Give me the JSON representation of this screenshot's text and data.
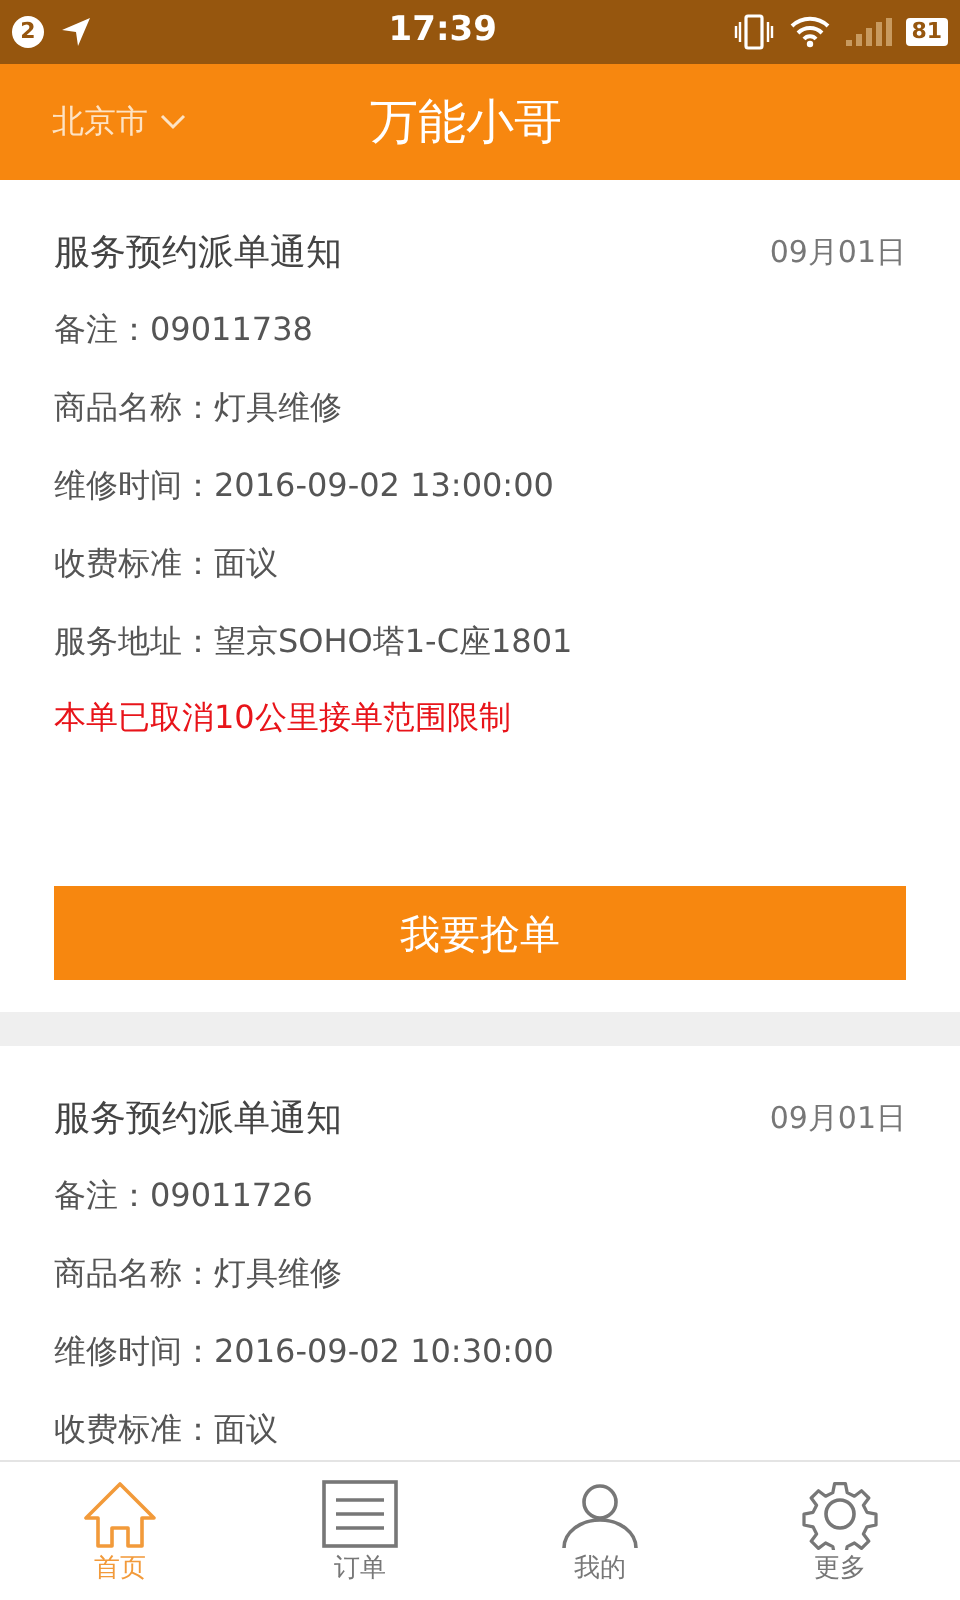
{
  "status_bar": {
    "notification_count": "2",
    "time": "17:39",
    "battery": "81"
  },
  "header": {
    "city": "北京市",
    "title": "万能小哥"
  },
  "orders": [
    {
      "title": "服务预约派单通知",
      "date": "09月01日",
      "fields": [
        {
          "label": "备注：",
          "value": "09011738"
        },
        {
          "label": "商品名称：",
          "value": "灯具维修"
        },
        {
          "label": "维修时间：",
          "value": "2016-09-02 13:00:00"
        },
        {
          "label": "收费标准：",
          "value": "面议"
        },
        {
          "label": "服务地址：",
          "value": "望京SOHO塔1-C座1801"
        }
      ],
      "notice": "本单已取消10公里接单范围限制",
      "button": "我要抢单"
    },
    {
      "title": "服务预约派单通知",
      "date": "09月01日",
      "fields": [
        {
          "label": "备注：",
          "value": "09011726"
        },
        {
          "label": "商品名称：",
          "value": "灯具维修"
        },
        {
          "label": "维修时间：",
          "value": "2016-09-02 10:30:00"
        },
        {
          "label": "收费标准：",
          "value": "面议"
        }
      ]
    }
  ],
  "tabs": [
    {
      "label": "首页",
      "kind": "home",
      "selected": true
    },
    {
      "label": "订单",
      "kind": "list",
      "selected": false
    },
    {
      "label": "我的",
      "kind": "person",
      "selected": false
    },
    {
      "label": "更多",
      "kind": "gear",
      "selected": false
    }
  ]
}
